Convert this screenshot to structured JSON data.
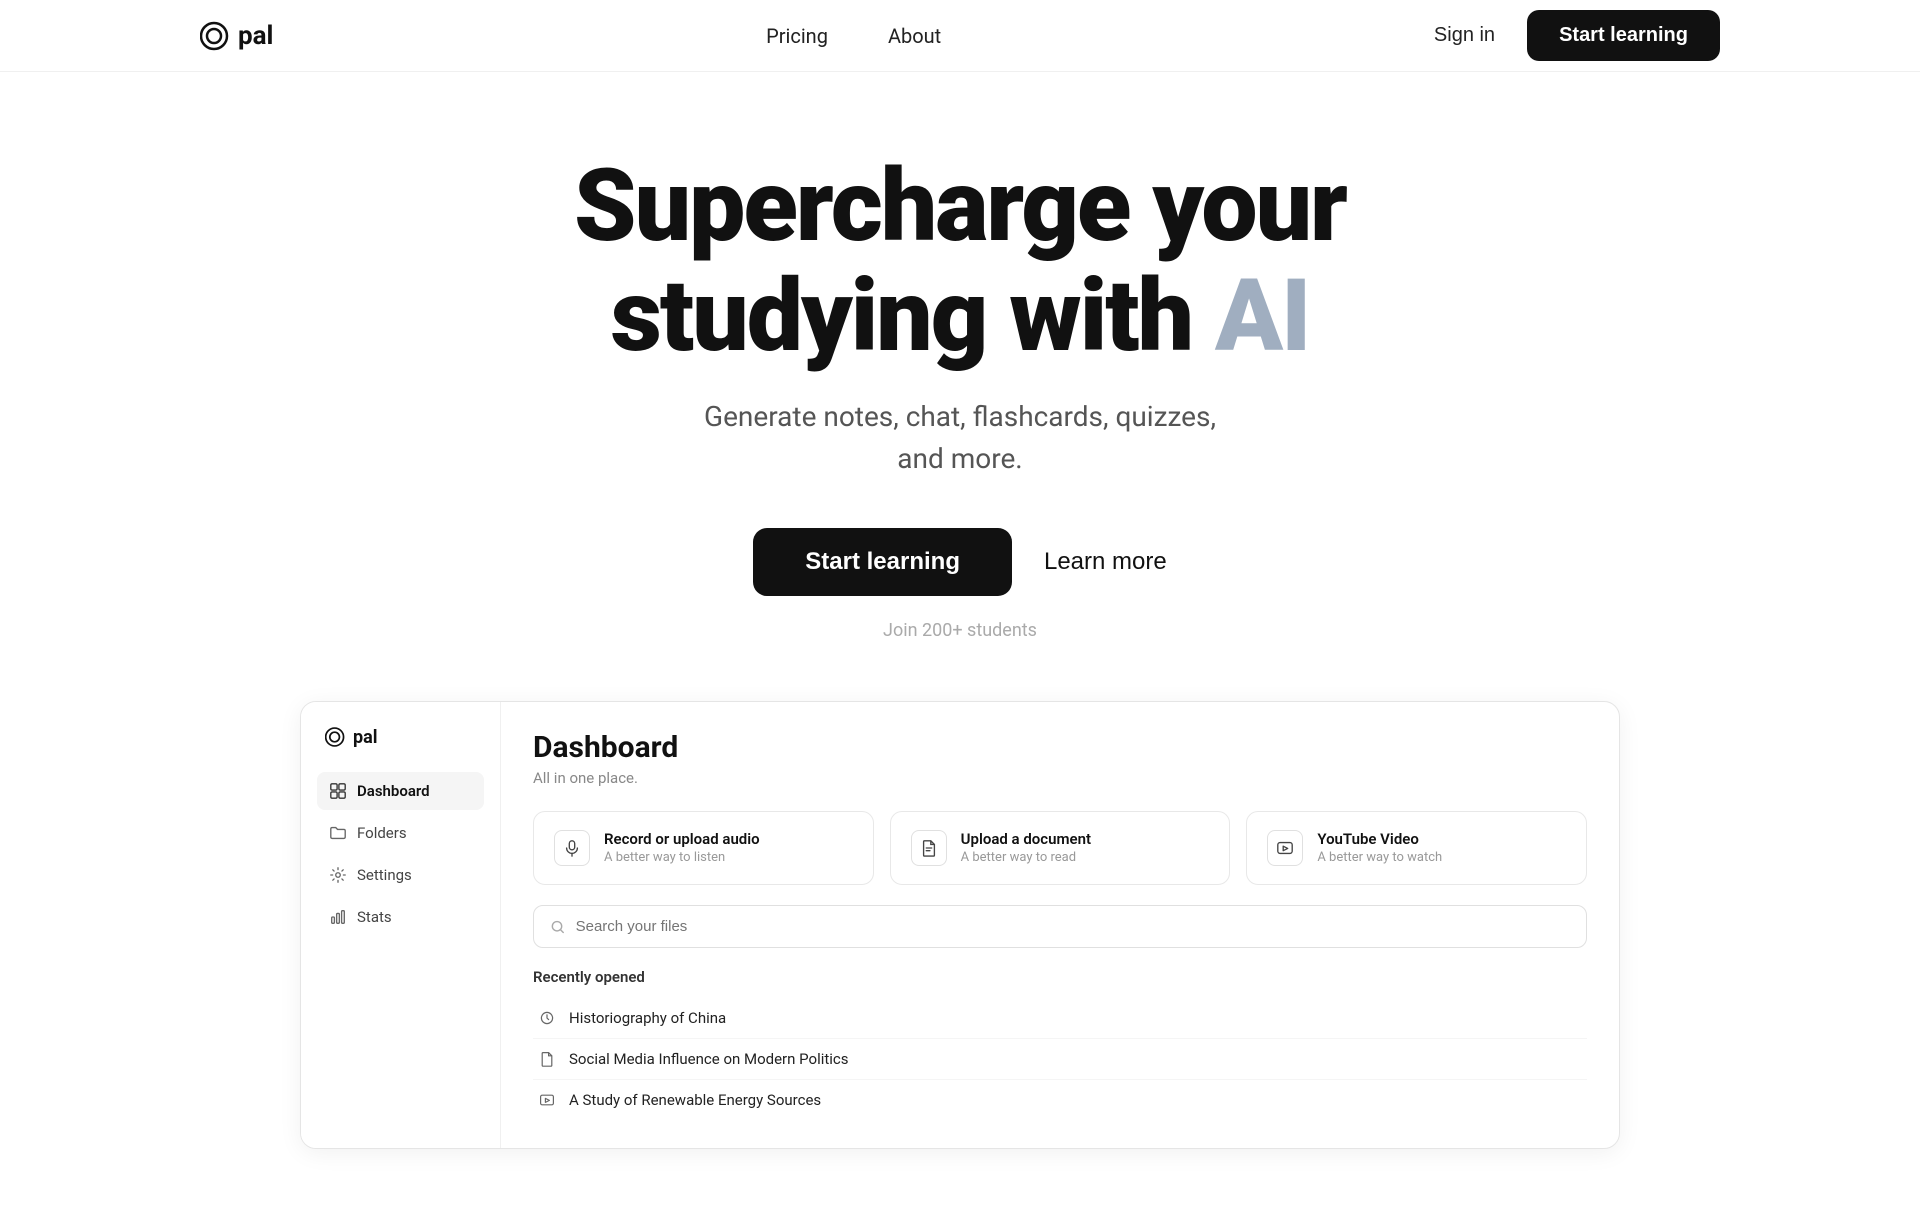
{
  "navbar": {
    "logo_text": "pal",
    "nav_links": [
      {
        "label": "Pricing",
        "id": "pricing"
      },
      {
        "label": "About",
        "id": "about"
      }
    ],
    "sign_in_label": "Sign in",
    "start_learning_label": "Start learning"
  },
  "hero": {
    "title_line1_bold": "Supercharge",
    "title_line1_normal": " your",
    "title_line2_normal": "studying with ",
    "title_line2_ai": "AI",
    "subtitle_line1": "Generate notes, chat, flashcards, quizzes,",
    "subtitle_line2": "and more.",
    "btn_primary": "Start learning",
    "btn_secondary": "Learn more",
    "social_proof": "Join 200+ students"
  },
  "dashboard_preview": {
    "sidebar": {
      "logo_text": "pal",
      "items": [
        {
          "label": "Dashboard",
          "id": "dashboard",
          "active": true
        },
        {
          "label": "Folders",
          "id": "folders",
          "active": false
        },
        {
          "label": "Settings",
          "id": "settings",
          "active": false
        },
        {
          "label": "Stats",
          "id": "stats",
          "active": false
        }
      ]
    },
    "main": {
      "title": "Dashboard",
      "subtitle": "All in one place.",
      "upload_cards": [
        {
          "id": "audio",
          "title": "Record or upload audio",
          "subtitle": "A better way to listen"
        },
        {
          "id": "document",
          "title": "Upload a document",
          "subtitle": "A better way to read"
        },
        {
          "id": "youtube",
          "title": "YouTube Video",
          "subtitle": "A better way to watch"
        }
      ],
      "search_placeholder": "Search your files",
      "recently_opened_label": "Recently opened",
      "recent_items": [
        {
          "label": "Historiography of China",
          "type": "audio"
        },
        {
          "label": "Social Media Influence on Modern Politics",
          "type": "document"
        },
        {
          "label": "A Study of Renewable Energy Sources",
          "type": "video"
        }
      ]
    }
  }
}
